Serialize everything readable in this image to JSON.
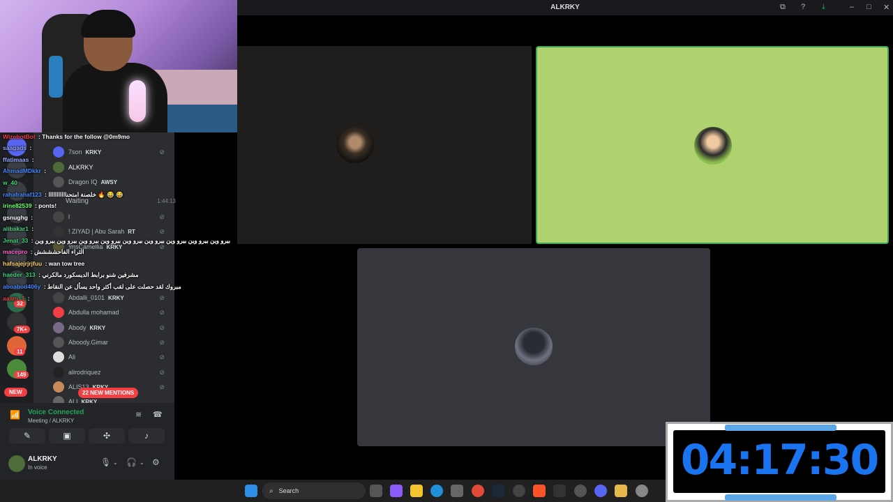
{
  "window": {
    "title": "ALKRKY"
  },
  "chat": [
    {
      "user": "WizebotBot",
      "color": "#f23f43",
      "text": " : Thanks for the follow @0m9mo"
    },
    {
      "user": "saagads",
      "color": "#9aa9ff",
      "text": " :"
    },
    {
      "user": "ffatimaas",
      "color": "#9aa9ff",
      "text": " :"
    },
    {
      "user": "AhmadMDkkr",
      "color": "#4a89ff",
      "text": " :"
    },
    {
      "user": "w_40",
      "color": "#3fd67a",
      "text": ""
    },
    {
      "user": "rahafrahaf123",
      "color": "#4a89ff",
      "text": " : خلصنة امتحنااااااااااا 🔥 😂 😂"
    },
    {
      "user": "irine82539",
      "color": "#6cff6c",
      "text": " : ponts!"
    },
    {
      "user": "gsnughg",
      "color": "#ffffff",
      "text": " :"
    },
    {
      "user": "alibakar1",
      "color": "#4ad17e",
      "text": " :"
    },
    {
      "user": "Jenat_33",
      "color": "#3fd67a",
      "text": " : بيرو وين بيرو وين بيرو وين بيرو وين بيرو وين بيرو وين بيرو وين بيرو وين بيرو وين"
    },
    {
      "user": "macepro",
      "color": "#ff66cc",
      "text": " : الثراء الفاحشششش"
    },
    {
      "user": "hafsajejrjrjfuu",
      "color": "#ffd166",
      "text": " : wan tow tree"
    },
    {
      "user": "haeder_313",
      "color": "#3fd67a",
      "text": " : مشرفين شنو برابط الديسكورد مالكرني"
    },
    {
      "user": "aboabod406y",
      "color": "#4a89ff",
      "text": " : مبروك لقد حصلت على لقب أكثر واحد يسأل عن النقاط"
    },
    {
      "user": "aaam_1",
      "color": "#f23f43",
      "text": " :"
    }
  ],
  "members": [
    {
      "name": "7son",
      "tag": "KRKY"
    },
    {
      "name": "ALKRKY",
      "tag": ""
    },
    {
      "name": "Dragon IQ",
      "tag": "AWSY"
    },
    {
      "name": "Waiting",
      "tag": ""
    },
    {
      "name": "l",
      "tag": ""
    },
    {
      "name": "! ZIYAD | Abu Sarah",
      "tag": "RT"
    },
    {
      "name": "!msCamellia",
      "tag": "KRKY"
    },
    {
      "name": "Abdalli_0101",
      "tag": "KRKY"
    },
    {
      "name": "Abdulla mohamad",
      "tag": ""
    },
    {
      "name": "Abody",
      "tag": "KRKY"
    },
    {
      "name": "Aboody.Gimar",
      "tag": ""
    },
    {
      "name": "Ali",
      "tag": ""
    },
    {
      "name": "alirodriquez",
      "tag": ""
    },
    {
      "name": "ALIS13",
      "tag": "KRKY"
    },
    {
      "name": "ALI",
      "tag": "KRKY"
    }
  ],
  "waiting_time": "1:44:13",
  "server_badges": {
    "b1": "32",
    "b2": "7K+",
    "b3": "11",
    "b4": "149",
    "new": "NEW"
  },
  "mentions": "22 NEW MENTIONS",
  "voice": {
    "status": "Voice Connected",
    "channel": "Meeting / ALKRKY"
  },
  "user": {
    "name": "ALKRKY",
    "status": "In voice"
  },
  "timer": "04:17:30",
  "taskbar": {
    "search_placeholder": "Search"
  },
  "colors": {
    "accent_green": "#23a55a",
    "timer_blue": "#1a74f0",
    "tile_green": "#b0d16f"
  }
}
